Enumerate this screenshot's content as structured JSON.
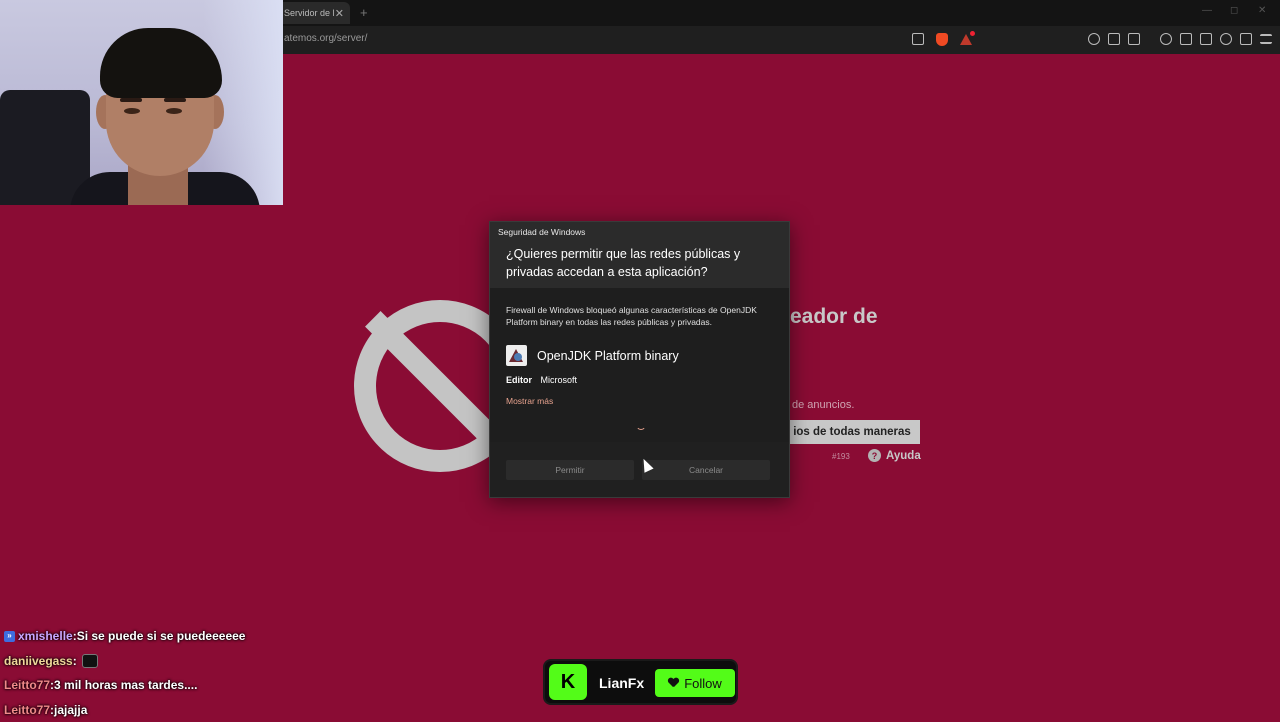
{
  "browser": {
    "tab_title": "Servidor de l",
    "tab_close": "✕",
    "new_tab": "+",
    "url": "atemos.org/server/"
  },
  "page": {
    "heading": "eador de",
    "subtext": "de anuncios.",
    "ads_button": "ios de todas maneras",
    "server_id": "#193",
    "help": "Ayuda",
    "help_glyph": "?"
  },
  "dialog": {
    "caption": "Seguridad de Windows",
    "question": "¿Quieres permitir que las redes públicas y privadas accedan a esta aplicación?",
    "body": "Firewall de Windows bloqueó algunas características de OpenJDK Platform binary en todas las redes públicas y privadas.",
    "app_name": "OpenJDK Platform binary",
    "publisher_label": "Editor",
    "publisher_value": "Microsoft",
    "show_more": "Mostrar más",
    "allow_button": "Permitir",
    "cancel_button": "Cancelar"
  },
  "chat": {
    "messages": [
      {
        "user": "xmishelle",
        "sep": " : ",
        "text": "Si se puede si se puedeeeeee"
      },
      {
        "user": "daniivegass",
        "sep": " : ",
        "text": ""
      },
      {
        "user": "Leitto77",
        "sep": " : ",
        "text": "3 mil horas mas tardes...."
      },
      {
        "user": "Leitto77",
        "sep": " : ",
        "text": "jajajja"
      }
    ]
  },
  "kick": {
    "logo": "K",
    "streamer": "LianFx",
    "follow_label": "Follow"
  },
  "colors": {
    "page_bg": "#8a0c34",
    "kick_green": "#53fc18",
    "dialog_bg": "#1e1e1e",
    "link_accent": "#e8a38f"
  }
}
